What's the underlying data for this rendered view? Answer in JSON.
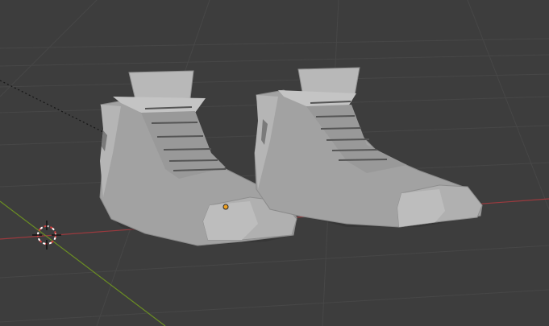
{
  "viewport": {
    "background_color": "#3d3d3d",
    "grid_line_color": "#4a4a4a",
    "x_axis_color": "#a53a3f",
    "y_axis_color": "#6b8e23",
    "mesh_color": "#9a9a9a",
    "origin_point_color": "#f0a020"
  },
  "scene": {
    "objects": [
      {
        "type": "mesh",
        "shape": "shoe",
        "side": "left",
        "selected": true
      },
      {
        "type": "mesh",
        "shape": "shoe",
        "side": "right",
        "selected": false
      }
    ],
    "cursor_icon": "3d-cursor-icon",
    "camera_guide": "dashed-line"
  }
}
